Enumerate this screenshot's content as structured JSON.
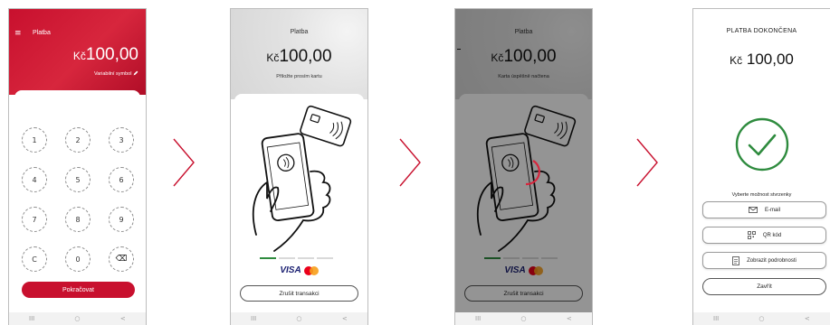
{
  "currency": "Kč",
  "amount": "100,00",
  "accent_color": "#c8102e",
  "success_color": "#2e8b3e",
  "screen1": {
    "menu_icon": "≡",
    "title": "Platba",
    "variable_symbol_label": "Variabilní symbol",
    "keys": [
      "1",
      "2",
      "3",
      "4",
      "5",
      "6",
      "7",
      "8",
      "9",
      "C",
      "0",
      "⌫"
    ],
    "continue_label": "Pokračovat"
  },
  "screen2": {
    "title": "Platba",
    "message": "Přiložte prosím kartu",
    "cancel_label": "Zrušit transakci",
    "card_brand": "VISA"
  },
  "screen3": {
    "title": "Platba",
    "message": "Karta úspěšně načtena",
    "cancel_label": "Zrušit transakci",
    "card_brand": "VISA"
  },
  "screen4": {
    "title": "PLATBA DOKONČENA",
    "receipt_prompt": "Vyberte možnost stvrzenky",
    "email_label": "E-mail",
    "qr_label": "QR kód",
    "details_label": "Zobrazit podrobnosti",
    "close_label": "Zavřít"
  },
  "navbar": {
    "recents_icon": "III",
    "home_icon": "○",
    "back_icon": "<"
  }
}
